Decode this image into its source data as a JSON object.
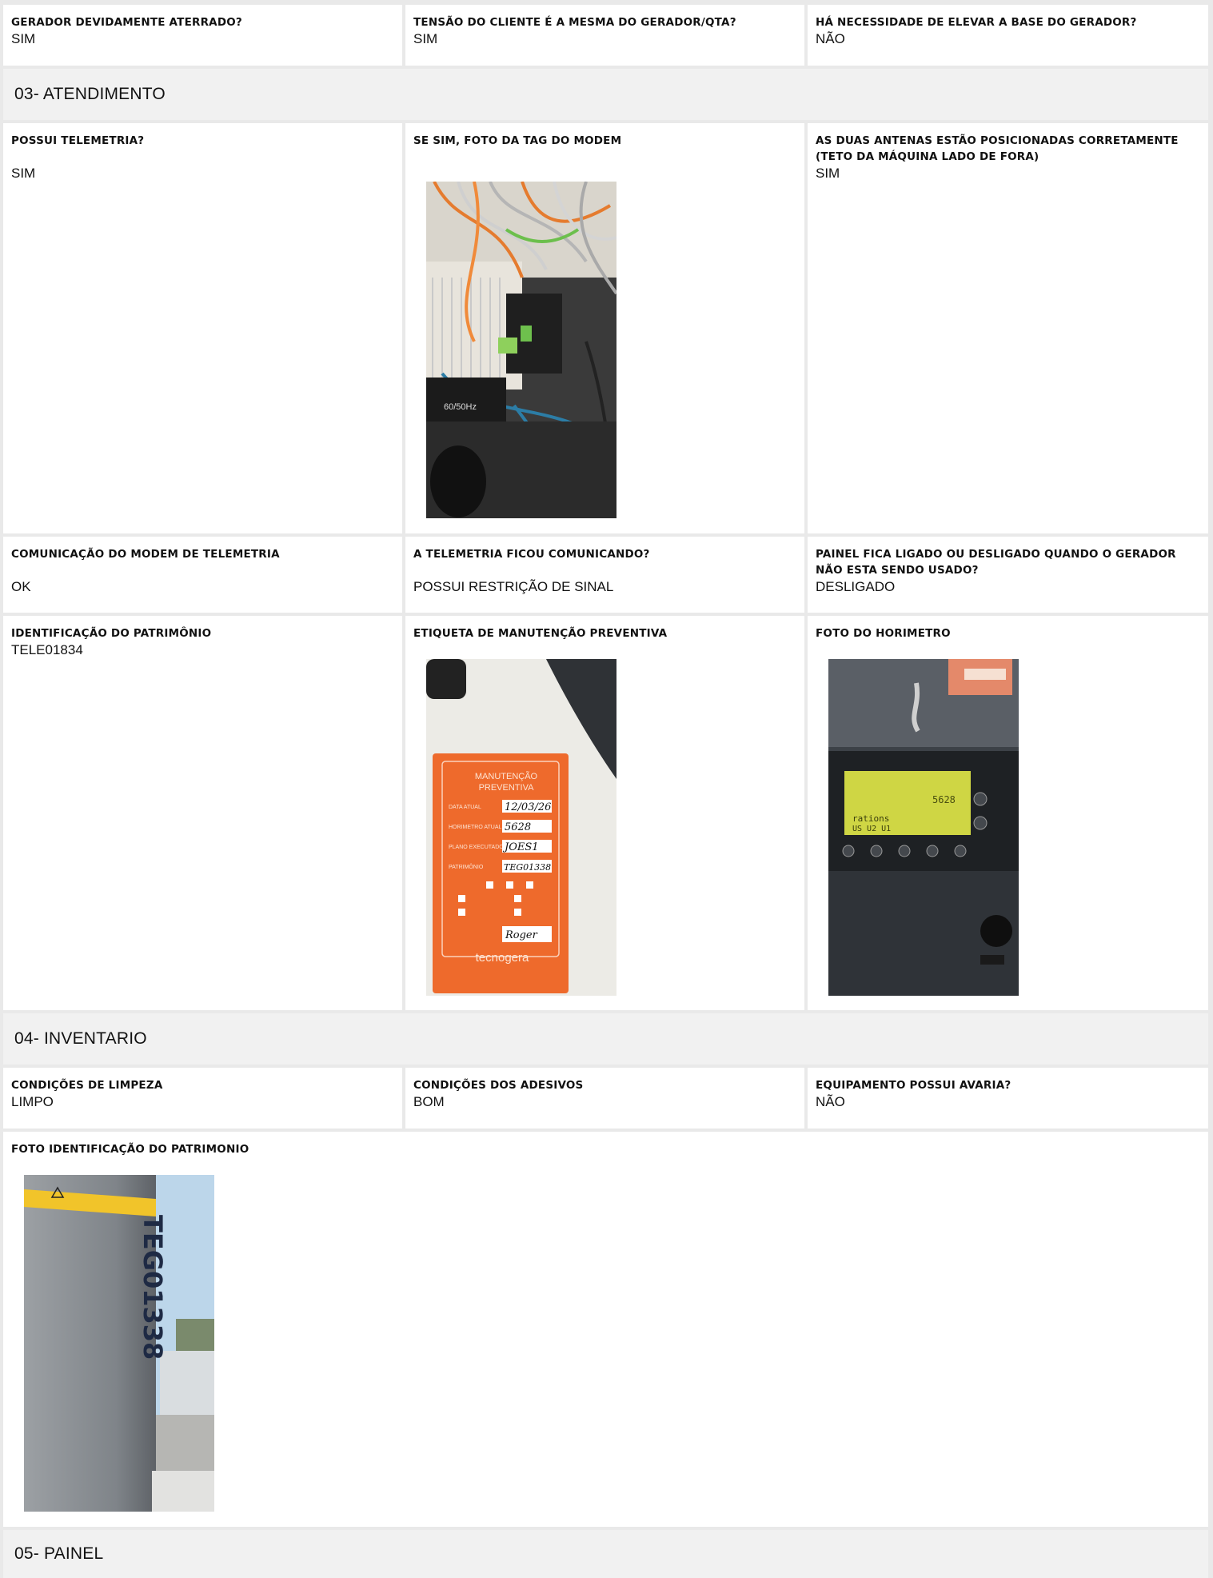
{
  "row1": [
    {
      "label": "GERADOR DEVIDAMENTE ATERRADO?",
      "value": "SIM"
    },
    {
      "label": "TENSÃO DO CLIENTE É A MESMA DO GERADOR/QTA?",
      "value": "SIM"
    },
    {
      "label": "HÁ NECESSIDADE DE ELEVAR A BASE DO GERADOR?",
      "value": "NÃO"
    }
  ],
  "section03": {
    "title": "03- ATENDIMENTO"
  },
  "row2": [
    {
      "label": "POSSUI TELEMETRIA?",
      "value": "SIM"
    },
    {
      "label": "SE SIM, FOTO DA TAG DO MODEM",
      "photo": "modem-tag-photo"
    },
    {
      "label": "AS DUAS ANTENAS ESTÃO POSICIONADAS CORRETAMENTE (TETO DA MÁQUINA LADO DE FORA)",
      "value": "SIM"
    }
  ],
  "row3": [
    {
      "label": "COMUNICAÇÃO DO MODEM DE TELEMETRIA",
      "value": "OK"
    },
    {
      "label": "A TELEMETRIA FICOU COMUNICANDO?",
      "value": "POSSUI RESTRIÇÃO DE SINAL"
    },
    {
      "label": "PAINEL FICA LIGADO OU DESLIGADO QUANDO O GERADOR NÃO ESTA SENDO USADO?",
      "value": "DESLIGADO"
    }
  ],
  "row4": [
    {
      "label": "IDENTIFICAÇÃO DO PATRIMÔNIO",
      "value": "TELE01834"
    },
    {
      "label": "ETIQUETA DE MANUTENÇÃO PREVENTIVA",
      "photo": "maintenance-label-photo"
    },
    {
      "label": "FOTO DO HORIMETRO",
      "photo": "hourmeter-photo"
    }
  ],
  "section04": {
    "title": "04- INVENTARIO"
  },
  "row5": [
    {
      "label": "CONDIÇÕES DE LIMPEZA",
      "value": "LIMPO"
    },
    {
      "label": "CONDIÇÕES DOS ADESIVOS",
      "value": "BOM"
    },
    {
      "label": "EQUIPAMENTO POSSUI AVARIA?",
      "value": "NÃO"
    }
  ],
  "row6": {
    "label": "FOTO IDENTIFICAÇÃO DO PATRIMONIO",
    "photo": "asset-id-photo"
  },
  "section05": {
    "title": "05- PAINEL"
  },
  "photos": {
    "maintenance_label": {
      "title_line1": "MANUTENÇÃO",
      "title_line2": "PREVENTIVA",
      "data_atual_label": "DATA ATUAL",
      "data_atual": "12/03/26",
      "horimetro_label": "HORIMETRO ATUAL",
      "horimetro": "5628",
      "plano_label": "PLANO EXECUTADO",
      "plano": "JOES1",
      "patrimonio_label": "PATRIMÔNIO",
      "patrimonio": "TEG01338",
      "brand": "tecnogera"
    },
    "hourmeter": {
      "lcd_line1": "5628",
      "lcd_line2": "rations",
      "lcd_line3": "US U2 U1"
    },
    "asset_id": {
      "stencil": "TEG01338"
    }
  },
  "colors": {
    "accent_orange": "#ee6a2c",
    "section_bg": "#f1f1f1",
    "border": "#e6e6e6"
  }
}
